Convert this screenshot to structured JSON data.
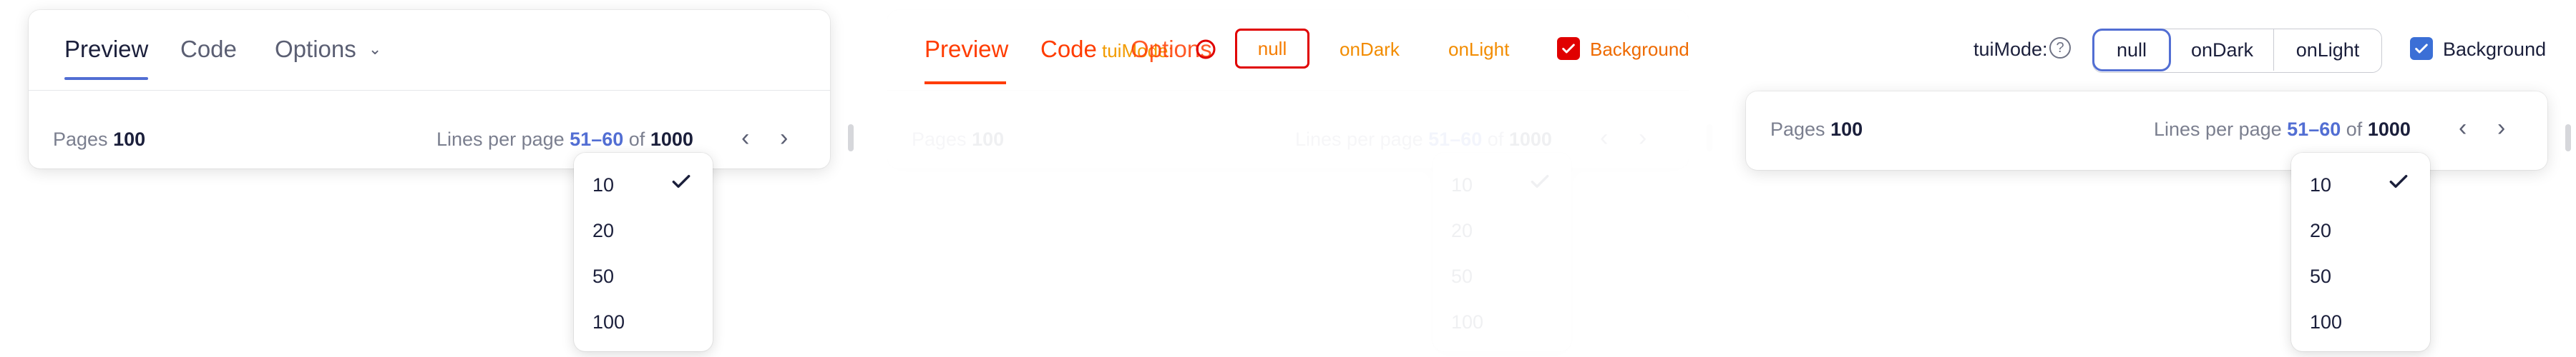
{
  "colors": {
    "accent": "#526ed3",
    "text": "#1b1f3b",
    "muted": "#7b7f8f",
    "debug_red": "#e00000",
    "debug_orange": "#f57c00"
  },
  "tabs": {
    "preview": "Preview",
    "code": "Code",
    "options": "Options"
  },
  "pagination": {
    "pages_label": "Pages",
    "pages_total": "100",
    "lines_label": "Lines per page",
    "range": "51–60",
    "of_label": "of",
    "total": "1000"
  },
  "page_size_options": [
    "10",
    "20",
    "50",
    "100"
  ],
  "selected_page_size": "10",
  "toolbar": {
    "mode_label": "tuiMode:",
    "mode_options": [
      "null",
      "onDark",
      "onLight"
    ],
    "selected_mode": "null",
    "background_label": "Background",
    "background_checked": true
  },
  "debug_overlay": {
    "tab_preview": "Preview",
    "tab_code": "Code",
    "tab_options": "Options",
    "mode_label": "tuiMode:",
    "mode_options": [
      "null",
      "onDark",
      "onLight"
    ],
    "background_label": "Background"
  },
  "icons": {
    "chevron_down": "⌄",
    "prev": "‹",
    "next": "›",
    "help": "?",
    "check": "✓"
  }
}
